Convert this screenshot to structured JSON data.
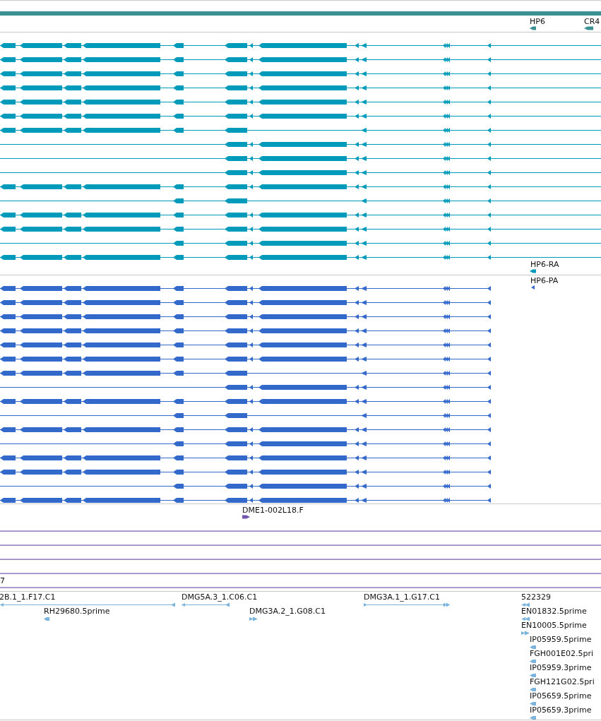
{
  "genes": [
    {
      "label": "HP6",
      "reverse": true
    },
    {
      "label": "CR4",
      "reverse": true
    }
  ],
  "rna_track": {
    "label": "HP6-RA",
    "rows": [
      {
        "kind": "full"
      },
      {
        "kind": "full"
      },
      {
        "kind": "full"
      },
      {
        "kind": "full"
      },
      {
        "kind": "full"
      },
      {
        "kind": "full"
      },
      {
        "kind": "skip"
      },
      {
        "kind": "short"
      },
      {
        "kind": "short"
      },
      {
        "kind": "short"
      },
      {
        "kind": "full"
      },
      {
        "kind": "minimal"
      },
      {
        "kind": "full"
      },
      {
        "kind": "full"
      },
      {
        "kind": "partial"
      },
      {
        "kind": "full"
      }
    ]
  },
  "protein_track": {
    "label": "HP6-PA",
    "rows": [
      {
        "kind": "full"
      },
      {
        "kind": "full"
      },
      {
        "kind": "full"
      },
      {
        "kind": "full"
      },
      {
        "kind": "full"
      },
      {
        "kind": "full"
      },
      {
        "kind": "skip"
      },
      {
        "kind": "short"
      },
      {
        "kind": "full"
      },
      {
        "kind": "minimal"
      },
      {
        "kind": "full"
      },
      {
        "kind": "partial"
      },
      {
        "kind": "full"
      },
      {
        "kind": "full"
      },
      {
        "kind": "partial"
      },
      {
        "kind": "full"
      }
    ]
  },
  "clone": {
    "label": "DME1-002L18.F",
    "reverse": false
  },
  "alignment_track": {
    "label": "7"
  },
  "ests": [
    {
      "label": "2B.1_1.F17.C1",
      "reverse": true
    },
    {
      "label": "DMG5A.3_1.C06.C1",
      "reverse": true
    },
    {
      "label": "DMG3A.1_1.G17.C1",
      "reverse": false
    },
    {
      "label": "522329",
      "reverse": true
    },
    {
      "label": "RH29680.5prime",
      "reverse": true
    },
    {
      "label": "DMG3A.2_1.G08.C1",
      "reverse": false
    },
    {
      "label": "EN01832.5prime",
      "reverse": true
    },
    {
      "label": "EN10005.5prime",
      "reverse": false
    },
    {
      "label": "IP05959.5prime",
      "reverse": true
    },
    {
      "label": "FGH001E02.5pri",
      "reverse": true
    },
    {
      "label": "IP05959.3prime",
      "reverse": true
    },
    {
      "label": "FGH121G02.5pri",
      "reverse": true
    },
    {
      "label": "IP05659.5prime",
      "reverse": true
    },
    {
      "label": "IP05659.3prime",
      "reverse": true
    }
  ]
}
